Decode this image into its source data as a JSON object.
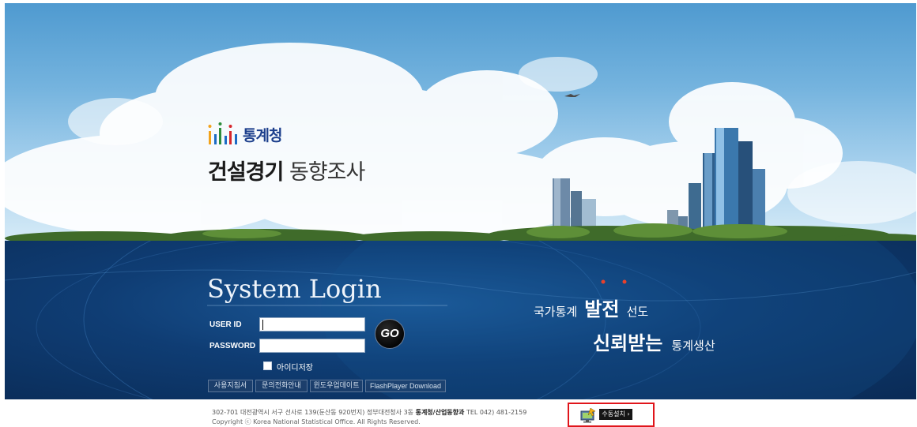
{
  "brand": {
    "org_name": "통계청",
    "title_strong": "건설경기",
    "title_light": "동향조사"
  },
  "login": {
    "title": "System Login",
    "userid_label": "USER ID",
    "password_label": "PASSWORD",
    "userid_value": "",
    "password_value": "",
    "go_label": "GO",
    "save_id_label": "아이디저장",
    "save_id_checked": false
  },
  "links": {
    "manual": "사용지침서",
    "contact": "문의전화안내",
    "update": "윈도우업데이트",
    "flash": "FlashPlayer Download"
  },
  "slogan": {
    "line1_prefix": "국가통계",
    "line1_strong": "발전",
    "line1_suffix": "선도",
    "line2_strong": "신뢰받는",
    "line2_suffix": "통계생산"
  },
  "footer": {
    "address": "302-701 대전광역시 서구 선사로 139(둔산동 920번지) 정부대전청사 3동",
    "department": "통계청/산업동향과",
    "tel": "TEL 042) 481-2159",
    "copyright": "Copyright ⓒ Korea National Statistical Office. All Rights Reserved.",
    "manual_install_label": "수동설치 ›"
  },
  "colors": {
    "panel_blue": "#0f3d74",
    "brand_blue": "#1c3f8c",
    "highlight_red": "#e0151b"
  }
}
